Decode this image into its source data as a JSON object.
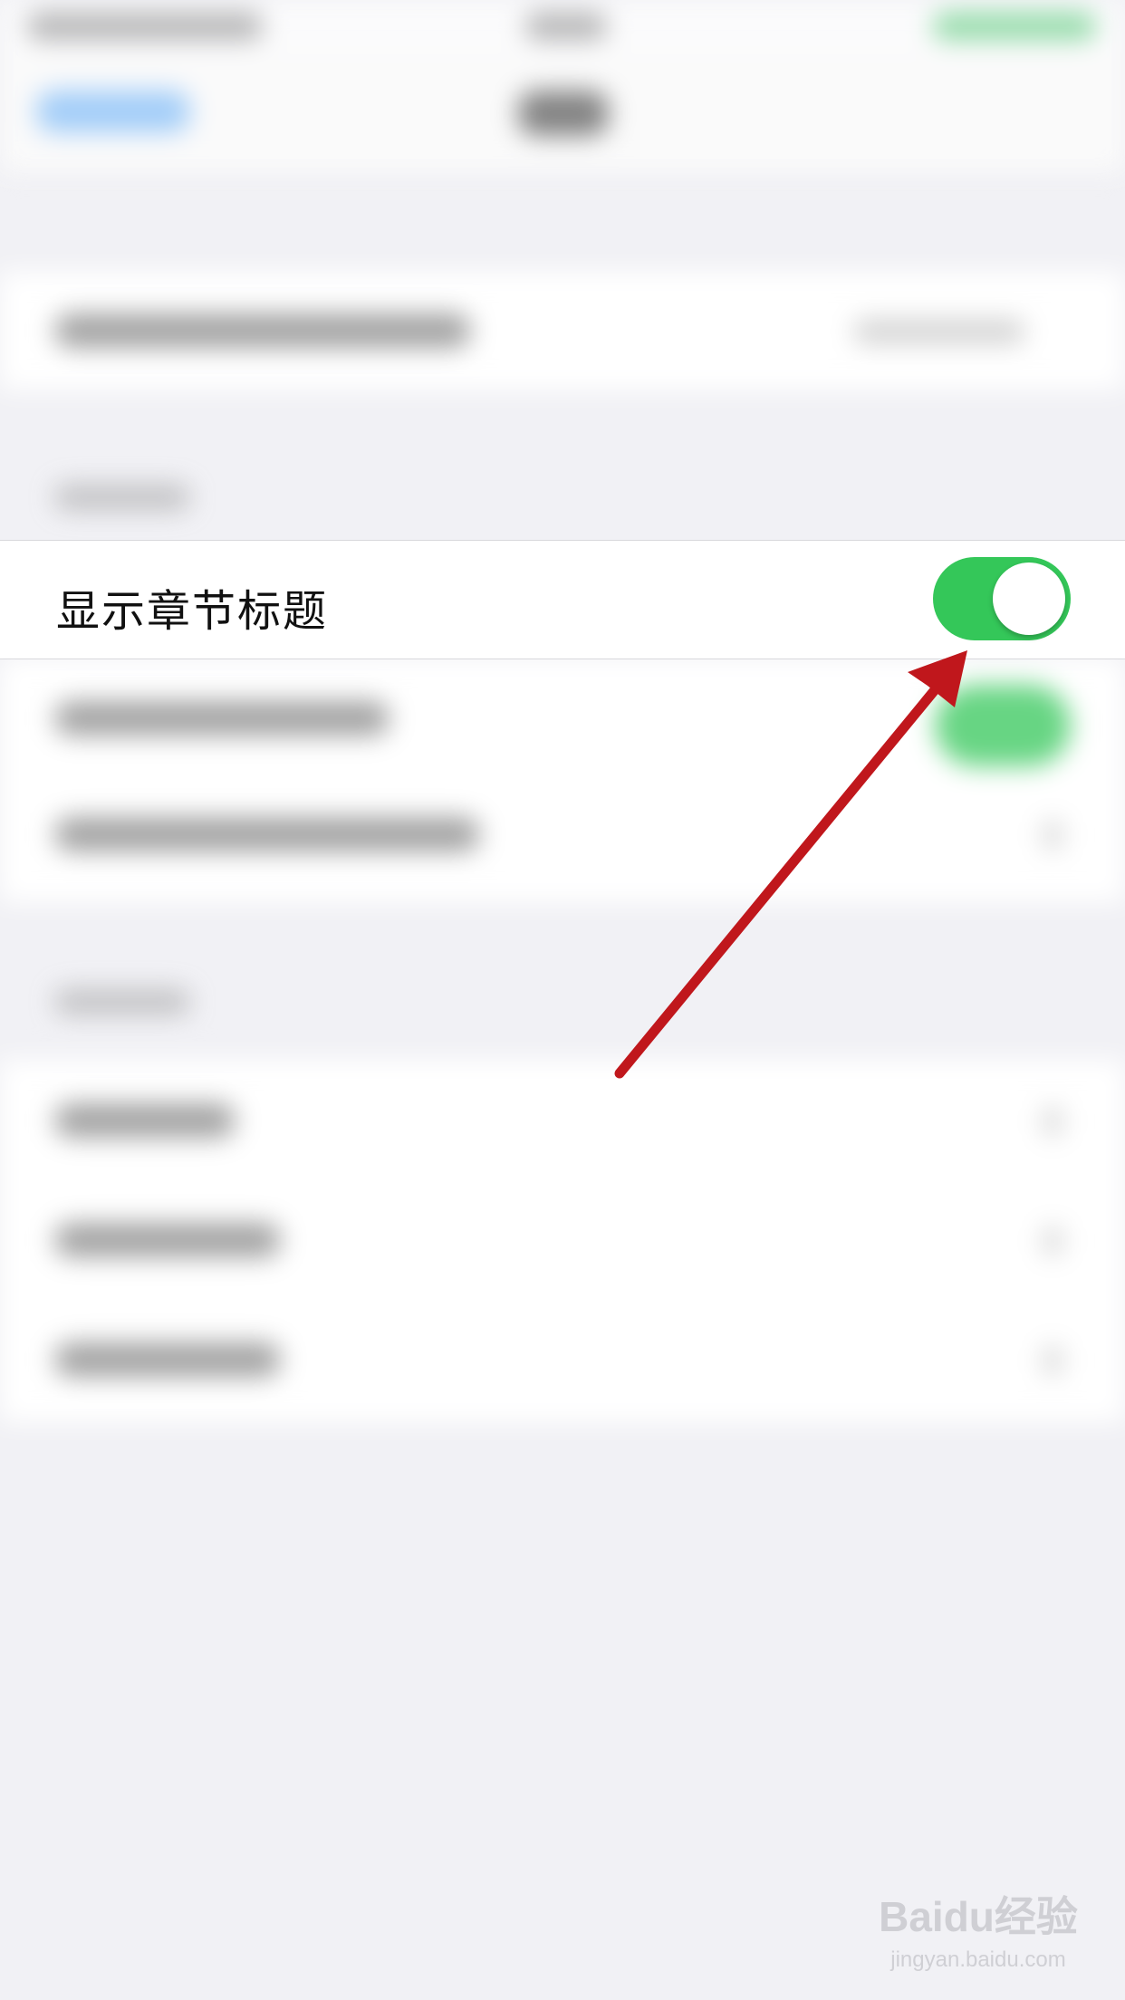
{
  "setting": {
    "label": "显示章节标题",
    "toggle_state": "on",
    "toggle_color": "#34c759"
  },
  "annotation": {
    "arrow_color": "#c0171c",
    "arrow_target": "toggle"
  },
  "watermark": {
    "main": "Baidu经验",
    "sub": "jingyan.baidu.com"
  }
}
